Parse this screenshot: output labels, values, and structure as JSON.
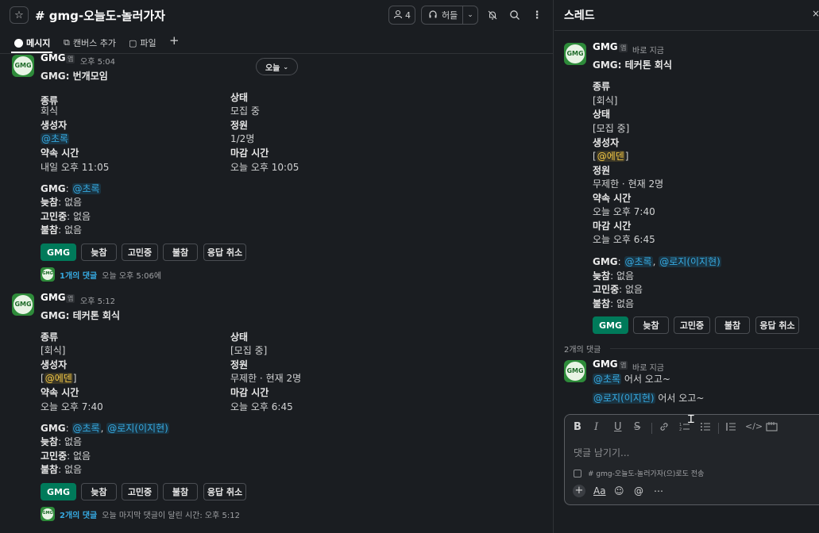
{
  "channel": {
    "title": "# gmg-오늘도-놀러가자",
    "member_count": "4",
    "huddle_label": "허들",
    "tabs": [
      {
        "label": "메시지"
      },
      {
        "label": "캔버스 추가"
      },
      {
        "label": "파일"
      }
    ],
    "date_pill": "오늘",
    "messages": [
      {
        "sender": "GMG",
        "badge": "앱",
        "time": "오후 5:04",
        "title": "GMG: 번개모임",
        "left_fields": [
          {
            "label": "종류",
            "value": "회식"
          },
          {
            "label": "생성자",
            "value": "@초록"
          },
          {
            "label": "약속 시간",
            "value": "내일 오후 11:05"
          }
        ],
        "right_fields": [
          {
            "label": "상태",
            "value": "모집 중"
          },
          {
            "label": "정원",
            "value": "1/2명"
          },
          {
            "label": "마감 시간",
            "value": "오늘 오후 10:05"
          }
        ],
        "responses": [
          {
            "label": "GMG",
            "value": "@초록"
          },
          {
            "label": "늦참",
            "value": "없음"
          },
          {
            "label": "고민중",
            "value": "없음"
          },
          {
            "label": "불참",
            "value": "없음"
          }
        ],
        "buttons": [
          "GMG",
          "늦참",
          "고민중",
          "불참",
          "응답 취소"
        ],
        "thread_link": "1개의 댓글",
        "thread_time": "오늘 오후 5:06에"
      },
      {
        "sender": "GMG",
        "badge": "앱",
        "time": "오후 5:12",
        "title": "GMG: 테커톤 회식",
        "left_fields": [
          {
            "label": "종류",
            "value": "[회식]"
          },
          {
            "label": "생성자",
            "prefix": "[",
            "value": "@에덴",
            "suffix": "]"
          },
          {
            "label": "약속 시간",
            "value": "오늘 오후 7:40"
          }
        ],
        "right_fields": [
          {
            "label": "상태",
            "value": "[모집 중]"
          },
          {
            "label": "정원",
            "value": "무제한 · 현재 2명"
          },
          {
            "label": "마감 시간",
            "value": "오늘 오후 6:45"
          }
        ],
        "responses": [
          {
            "label": "GMG",
            "value": "@초록",
            "value2": "@로지(이지현)"
          },
          {
            "label": "늦참",
            "value": "없음"
          },
          {
            "label": "고민중",
            "value": "없음"
          },
          {
            "label": "불참",
            "value": "없음"
          }
        ],
        "buttons": [
          "GMG",
          "늦참",
          "고민중",
          "불참",
          "응답 취소"
        ],
        "thread_link": "2개의 댓글",
        "thread_time": "오늘 마지막 댓글이 달린 시간: 오후 5:12"
      }
    ]
  },
  "thread": {
    "title": "스레드",
    "parent": {
      "sender": "GMG",
      "badge": "앱",
      "time": "바로 지금",
      "title": "GMG: 테커톤 회식",
      "fields": [
        {
          "label": "종류",
          "value": "[회식]"
        },
        {
          "label": "상태",
          "value": "[모집 중]"
        },
        {
          "label": "생성자",
          "prefix": "[",
          "value": "@에덴",
          "suffix": "]"
        },
        {
          "label": "정원",
          "value": "무제한 · 현재 2명"
        },
        {
          "label": "약속 시간",
          "value": "오늘 오후 7:40"
        },
        {
          "label": "마감 시간",
          "value": "오늘 오후 6:45"
        }
      ],
      "responses": [
        {
          "label": "GMG",
          "value": "@초록",
          "value2": "@로지(이지현)"
        },
        {
          "label": "늦참",
          "value": "없음"
        },
        {
          "label": "고민중",
          "value": "없음"
        },
        {
          "label": "불참",
          "value": "없음"
        }
      ],
      "buttons": [
        "GMG",
        "늦참",
        "고민중",
        "불참",
        "응답 취소"
      ]
    },
    "reply_count": "2개의 댓글",
    "reply": {
      "sender": "GMG",
      "badge": "앱",
      "time": "바로 지금",
      "line1_mention": "@초록",
      "line1_text": " 어서 오고~",
      "line2_mention": "@로지(이지현)",
      "line2_text": " 어서 오고~"
    },
    "composer": {
      "placeholder": "댓글 남기기...",
      "also_send_channel": "# gmg-오늘도-놀러가자",
      "also_send_suffix": "(으)로도 전송"
    }
  },
  "colors": {
    "background": "#1a1d21",
    "mention": "#36a9e1",
    "mention_yellow": "#f2c744",
    "primary_button": "#007a5a"
  }
}
